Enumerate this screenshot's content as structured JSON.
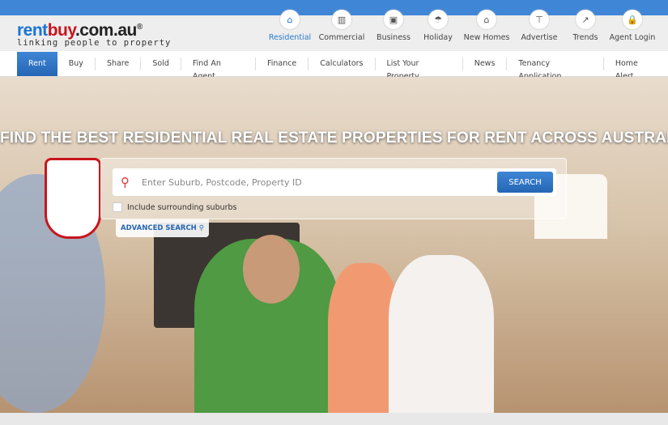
{
  "logo": {
    "rent": "rent",
    "buy": "buy",
    ".com.au": ".com.au",
    "reg": "®",
    "tagline": "linking people to property"
  },
  "categories": [
    {
      "label": "Residential",
      "icon": "house-icon",
      "glyph": "⌂"
    },
    {
      "label": "Commercial",
      "icon": "bar-chart-icon",
      "glyph": "▥"
    },
    {
      "label": "Business",
      "icon": "briefcase-icon",
      "glyph": "▣"
    },
    {
      "label": "Holiday",
      "icon": "umbrella-icon",
      "glyph": "☂"
    },
    {
      "label": "New Homes",
      "icon": "new-home-icon",
      "glyph": "⌂"
    },
    {
      "label": "Advertise",
      "icon": "signpost-icon",
      "glyph": "⊤"
    },
    {
      "label": "Trends",
      "icon": "trend-icon",
      "glyph": "↗"
    },
    {
      "label": "Agent Login",
      "icon": "lock-icon",
      "glyph": "🔒"
    }
  ],
  "nav": [
    "Rent",
    "Buy",
    "Share",
    "Sold",
    "Find An Agent",
    "Finance",
    "Calculators",
    "List Your Property",
    "News",
    "Tenancy Application",
    "Home Alert"
  ],
  "hero": {
    "headline": "FIND THE BEST RESIDENTIAL REAL ESTATE PROPERTIES FOR RENT ACROSS AUSTRALIA"
  },
  "search": {
    "placeholder": "Enter Suburb, Postcode, Property ID",
    "value": "",
    "button": "SEARCH",
    "include_label": "Include surrounding suburbs",
    "advanced": "ADVANCED SEARCH"
  },
  "colors": {
    "brand_blue": "#3f86d6",
    "brand_red": "#c8161d"
  }
}
